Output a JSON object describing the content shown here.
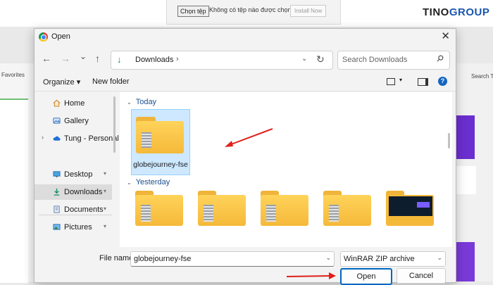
{
  "background": {
    "choose_file_label": "Chọn tệp",
    "no_file_text": "Không có tệp nào được chọn",
    "install_label": "Install Now",
    "brand_part1": "TINO",
    "brand_part2": "GROUP",
    "favorites_label": "Favorites",
    "search_label": "Search Tl"
  },
  "dialog": {
    "title": "Open",
    "close_glyph": "✕"
  },
  "nav": {
    "back_glyph": "←",
    "forward_glyph": "→",
    "recent_glyph": "⌄",
    "up_glyph": "↑",
    "address_icon": "↓",
    "address_text": "Downloads",
    "address_sep": "›",
    "address_chevron": "⌄",
    "refresh_glyph": "↻",
    "search_placeholder": "Search Downloads"
  },
  "toolbar": {
    "organize_label": "Organize ▾",
    "new_folder_label": "New folder",
    "view_caret": "▾",
    "help_glyph": "?"
  },
  "sidebar": {
    "items": [
      {
        "label": "Home",
        "icon": "home-icon"
      },
      {
        "label": "Gallery",
        "icon": "gallery-icon"
      },
      {
        "label": "Tung - Personal",
        "icon": "cloud-icon",
        "expand": "›"
      },
      {
        "label": "Desktop",
        "icon": "desktop-icon",
        "pin": "📌"
      },
      {
        "label": "Downloads",
        "icon": "download-icon",
        "pin": "📌",
        "selected": true
      },
      {
        "label": "Documents",
        "icon": "documents-icon",
        "pin": "📌"
      },
      {
        "label": "Pictures",
        "icon": "pictures-icon",
        "pin": "📌"
      }
    ]
  },
  "content": {
    "group_today": "Today",
    "group_yesterday": "Yesterday",
    "group_caret": "⌄",
    "selected_file": "globejourney-fse"
  },
  "footer": {
    "file_name_label": "File name:",
    "file_name_value": "globejourney-fse",
    "file_type_value": "WinRAR ZIP archive",
    "dropdown_glyph": "⌄",
    "open_label": "Open",
    "cancel_label": "Cancel"
  },
  "colors": {
    "accent": "#0067c0",
    "annotation_arrow": "#e0201b",
    "folder_yellow": "#f5b93a",
    "selection": "#cde8ff"
  }
}
